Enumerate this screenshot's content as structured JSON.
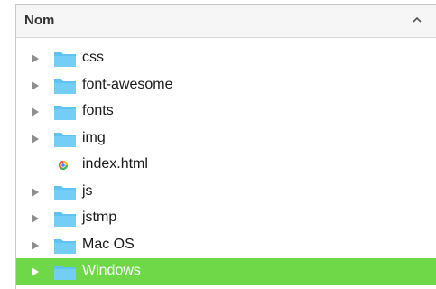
{
  "header": {
    "column_label": "Nom",
    "sort_icon": "chevron-up-icon"
  },
  "colors": {
    "folder": "#5ec3f0",
    "selection": "#6ed849",
    "disclosure": "#8e8e8e"
  },
  "rows": [
    {
      "name": "css",
      "kind": "folder",
      "selected": false
    },
    {
      "name": "font-awesome",
      "kind": "folder",
      "selected": false
    },
    {
      "name": "fonts",
      "kind": "folder",
      "selected": false
    },
    {
      "name": "img",
      "kind": "folder",
      "selected": false
    },
    {
      "name": "index.html",
      "kind": "file",
      "selected": false
    },
    {
      "name": "js",
      "kind": "folder",
      "selected": false
    },
    {
      "name": "jstmp",
      "kind": "folder",
      "selected": false
    },
    {
      "name": "Mac OS",
      "kind": "folder",
      "selected": false
    },
    {
      "name": "Windows",
      "kind": "folder",
      "selected": true
    }
  ]
}
